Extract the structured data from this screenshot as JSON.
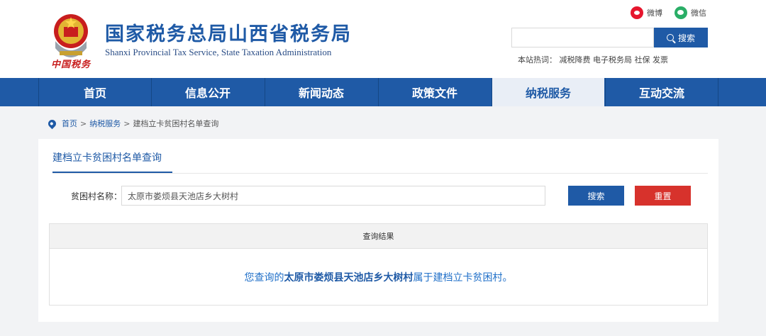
{
  "header": {
    "emblem_text": "中国税务",
    "title": "国家税务总局山西省税务局",
    "subtitle": "Shanxi Provincial Tax Service, State Taxation Administration",
    "social": {
      "weibo": "微博",
      "wechat": "微信"
    },
    "search": {
      "placeholder": "",
      "button_label": "搜索"
    },
    "hotwords": "本站热词： 减税降费 电子税务局 社保 发票"
  },
  "nav": {
    "items": [
      {
        "label": "首页"
      },
      {
        "label": "信息公开"
      },
      {
        "label": "新闻动态"
      },
      {
        "label": "政策文件"
      },
      {
        "label": "纳税服务"
      },
      {
        "label": "互动交流"
      }
    ],
    "active": "纳税服务"
  },
  "breadcrumb": {
    "home": "首页",
    "sep1": ">",
    "section": "纳税服务",
    "sep2": ">",
    "current": "建档立卡贫困村名单查询"
  },
  "card": {
    "tab": "建档立卡贫困村名单查询",
    "field_label": "贫困村名称：",
    "field_value": "太原市娄烦县天池店乡大树村",
    "search_button": "搜索",
    "reset_button": "重置",
    "result_header": "查询结果",
    "result_prefix": "您查询的",
    "result_village": "太原市娄烦县天池店乡大树村",
    "result_suffix": "属于建档立卡贫困村。"
  },
  "colors": {
    "brand_blue": "#1f5aa6",
    "reset_red": "#d7322c",
    "nav_active_bg": "#e9eef6"
  }
}
